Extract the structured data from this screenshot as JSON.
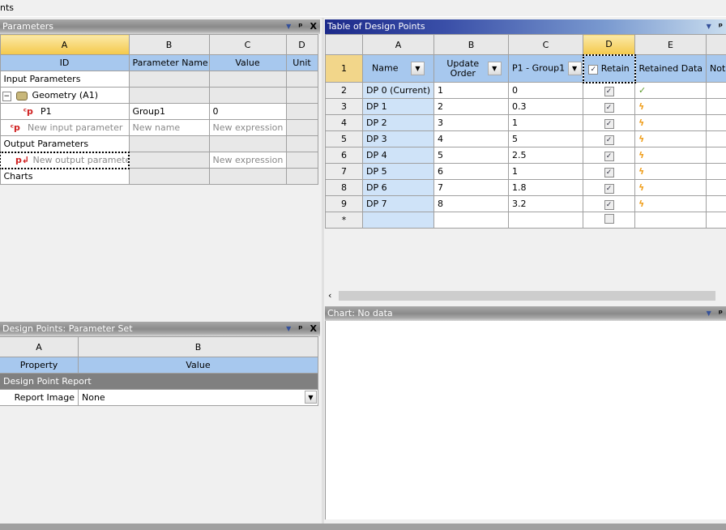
{
  "top": {
    "title_fragment": "nts"
  },
  "params": {
    "title": "Parameters",
    "cols": [
      "A",
      "B",
      "C",
      "D"
    ],
    "headers": [
      "ID",
      "Parameter Name",
      "Value",
      "Unit"
    ],
    "rows": [
      {
        "id": "Input Parameters",
        "name": "",
        "value": "",
        "type": "section"
      },
      {
        "id": "Geometry (A1)",
        "name": "",
        "value": "",
        "type": "geometry"
      },
      {
        "id": "P1",
        "name": "Group1",
        "value": "0",
        "type": "param"
      },
      {
        "id": "New input parameter",
        "name": "New name",
        "value": "New expression",
        "type": "new-input"
      },
      {
        "id": "Output Parameters",
        "name": "",
        "value": "",
        "type": "section"
      },
      {
        "id": "New output parameter",
        "name": "",
        "value": "New expression",
        "type": "new-output"
      },
      {
        "id": "Charts",
        "name": "",
        "value": "",
        "type": "section"
      }
    ]
  },
  "dp": {
    "title": "Table of Design Points",
    "cols": [
      "A",
      "B",
      "C",
      "D",
      "E"
    ],
    "header_row": "1",
    "headers": [
      "Name",
      "Update Order",
      "P1 - Group1",
      "Retain",
      "Retained Data",
      "Not"
    ],
    "rows": [
      {
        "n": "2",
        "name": "DP 0 (Current)",
        "order": "1",
        "p1": "0",
        "retain": true,
        "data": "check"
      },
      {
        "n": "3",
        "name": "DP 1",
        "order": "2",
        "p1": "0.3",
        "retain": true,
        "data": "lightning"
      },
      {
        "n": "4",
        "name": "DP 2",
        "order": "3",
        "p1": "1",
        "retain": true,
        "data": "lightning"
      },
      {
        "n": "5",
        "name": "DP 3",
        "order": "4",
        "p1": "5",
        "retain": true,
        "data": "lightning"
      },
      {
        "n": "6",
        "name": "DP 4",
        "order": "5",
        "p1": "2.5",
        "retain": true,
        "data": "lightning"
      },
      {
        "n": "7",
        "name": "DP 5",
        "order": "6",
        "p1": "1",
        "retain": true,
        "data": "lightning"
      },
      {
        "n": "8",
        "name": "DP 6",
        "order": "7",
        "p1": "1.8",
        "retain": true,
        "data": "lightning"
      },
      {
        "n": "9",
        "name": "DP 7",
        "order": "8",
        "p1": "3.2",
        "retain": true,
        "data": "lightning"
      },
      {
        "n": "*",
        "name": "",
        "order": "",
        "p1": "",
        "retain": false,
        "data": ""
      }
    ]
  },
  "chart": {
    "title": "Chart: No data"
  },
  "props": {
    "title": "Design Points: Parameter Set",
    "cols": [
      "A",
      "B"
    ],
    "headers": [
      "Property",
      "Value"
    ],
    "group": "Design Point Report",
    "rows": [
      {
        "prop": "Report Image",
        "value": "None"
      }
    ]
  }
}
